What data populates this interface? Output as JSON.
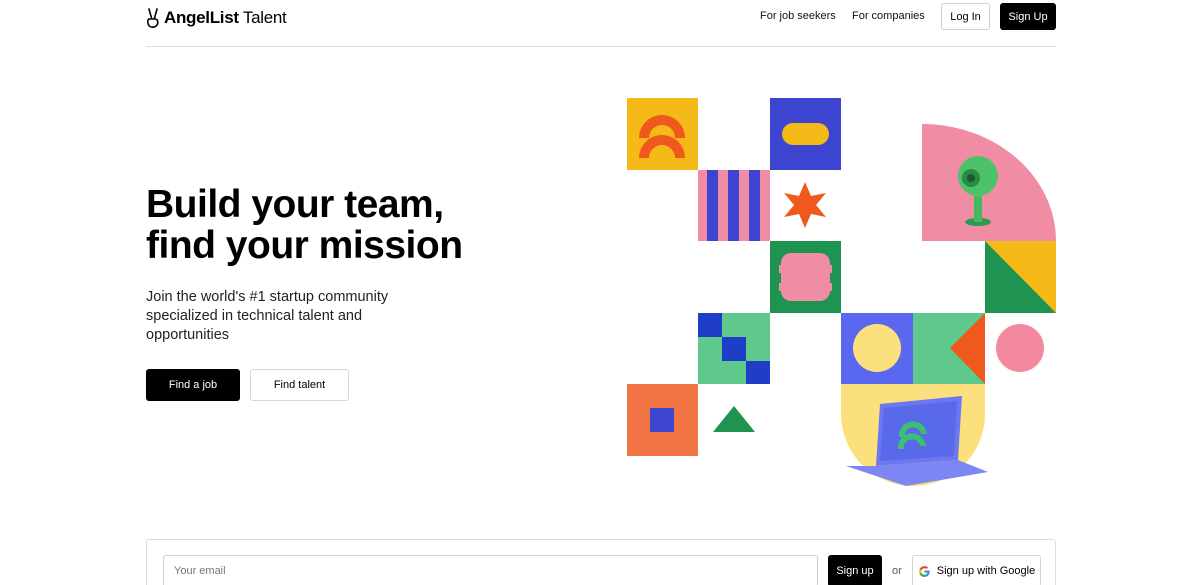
{
  "header": {
    "logo_bold": "AngelList",
    "logo_light": " Talent",
    "nav": {
      "job_seekers": "For job seekers",
      "companies": "For companies"
    },
    "login_label": "Log In",
    "signup_label": "Sign Up"
  },
  "hero": {
    "title_line1": "Build your team,",
    "title_line2": "find your mission",
    "subtitle": "Join the world's #1 startup community specialized in technical talent and opportunities",
    "find_job_label": "Find a job",
    "find_talent_label": "Find talent"
  },
  "signup_bar": {
    "email_placeholder": "Your email",
    "signup_label": "Sign up",
    "or_label": "or",
    "google_label": "Sign up with Google"
  },
  "colors": {
    "yellow": "#f5b918",
    "orange": "#f0591e",
    "blue": "#3d44d0",
    "pink": "#f08ca4",
    "green": "#1f9450",
    "mint": "#5ec98a",
    "coral": "#f07444",
    "periwinkle": "#5a68f0",
    "cream": "#fde07e",
    "light_pink": "#f4889e"
  }
}
